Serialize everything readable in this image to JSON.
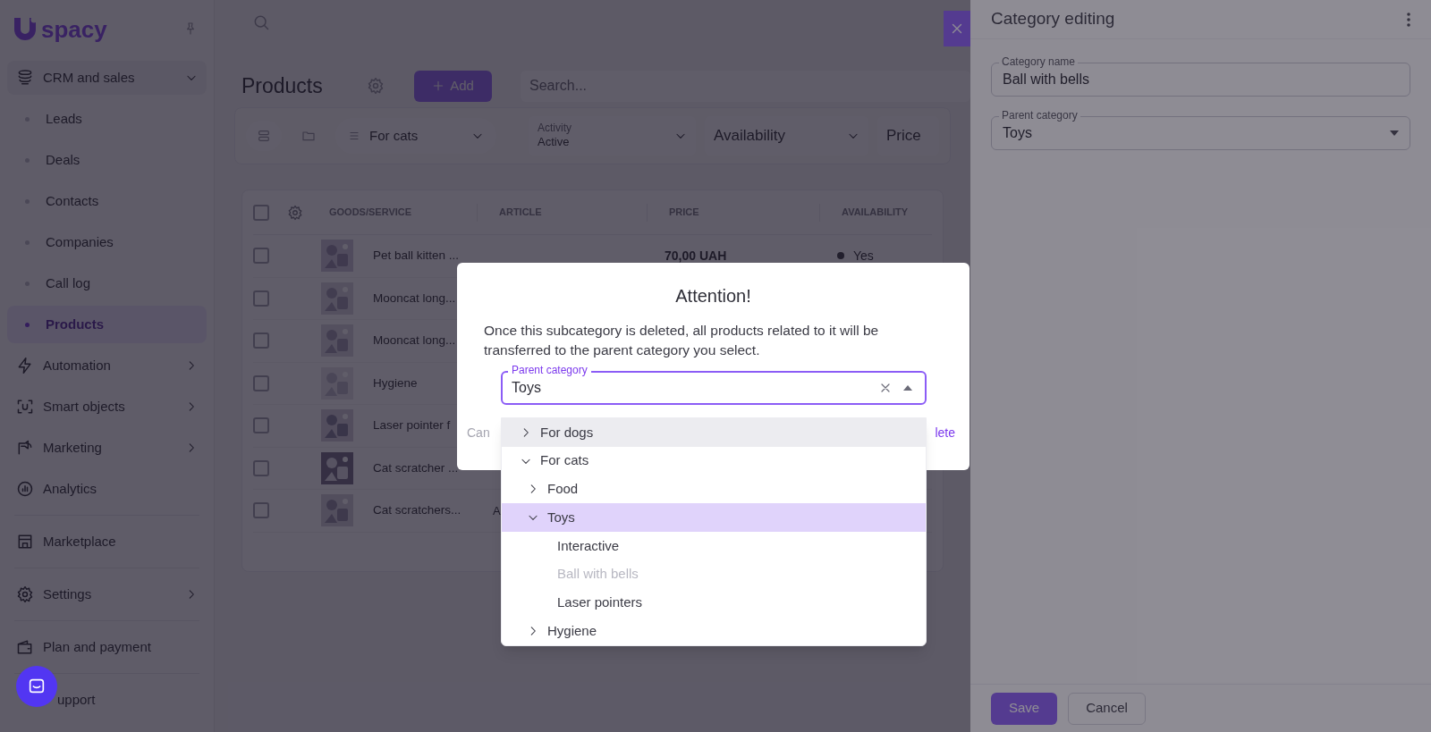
{
  "sidebar": {
    "logo": "spacy",
    "sections": [
      [
        {
          "label": "CRM and sales",
          "expanded": true,
          "children": [
            {
              "label": "Leads",
              "selected": false
            },
            {
              "label": "Deals",
              "selected": false
            },
            {
              "label": "Contacts",
              "selected": false
            },
            {
              "label": "Companies",
              "selected": false
            },
            {
              "label": "Call log",
              "selected": false
            },
            {
              "label": "Products",
              "selected": true
            }
          ]
        },
        {
          "label": "Automation",
          "expanded": false
        },
        {
          "label": "Smart objects",
          "expanded": false
        },
        {
          "label": "Marketing",
          "expanded": false
        },
        {
          "label": "Analytics"
        }
      ],
      [
        {
          "label": "Marketplace"
        }
      ],
      [
        {
          "label": "Settings",
          "expanded": false
        }
      ],
      [
        {
          "label": "Plan and payment"
        }
      ],
      [
        {
          "label": "upport"
        }
      ]
    ]
  },
  "products": {
    "title": "Products",
    "add_button": "Add",
    "search_placeholder": "Search...",
    "filters": {
      "category": "For cats",
      "activity_label": "Activity",
      "activity_value": "Active",
      "availability": "Availability",
      "price": "Price"
    },
    "table": {
      "header_checked": false,
      "columns": [
        "GOODS/SERVICE",
        "ARTICLE",
        "PRICE",
        "AVAILABILITY"
      ],
      "rows": [
        {
          "name": "Pet ball kitten ...",
          "price": "70,00 UAH",
          "availability": "Yes",
          "checked": false
        },
        {
          "name": "Mooncat long...",
          "checked": false
        },
        {
          "name": "Mooncat long...",
          "checked": false
        },
        {
          "name": "Hygiene",
          "checked": false
        },
        {
          "name": "Laser pointer f",
          "checked": false
        },
        {
          "name": "Cat scratcher ...",
          "checked": false
        },
        {
          "name": "Cat scratchers...",
          "article": "A",
          "checked": false
        }
      ]
    }
  },
  "drawer": {
    "title": "Category editing",
    "fields": [
      {
        "label": "Category name",
        "value": "Ball with bells",
        "kind": "text"
      },
      {
        "label": "Parent category",
        "value": "Toys",
        "kind": "select"
      }
    ],
    "save_button": "Save",
    "cancel_button": "Cancel"
  },
  "dialog": {
    "title": "Attention!",
    "message": "Once this subcategory is deleted, all products related to it will be transferred to the parent category you select.",
    "field": {
      "label": "Parent category",
      "value": "Toys"
    },
    "cancel_button": "Can",
    "delete_button": "lete",
    "options": [
      {
        "label": "For dogs",
        "expanded": false,
        "selected": false,
        "focused": true,
        "disabled": false
      },
      {
        "label": "For cats",
        "expanded": true,
        "selected": false,
        "focused": false,
        "disabled": false,
        "children": [
          {
            "label": "Food",
            "expanded": false,
            "selected": false,
            "focused": false,
            "disabled": false
          },
          {
            "label": "Toys",
            "expanded": true,
            "selected": true,
            "focused": false,
            "disabled": false,
            "children": [
              {
                "label": "Interactive",
                "selected": false,
                "focused": false,
                "disabled": false
              },
              {
                "label": "Ball with bells",
                "selected": false,
                "focused": false,
                "disabled": true
              },
              {
                "label": "Laser pointers",
                "selected": false,
                "focused": false,
                "disabled": false
              }
            ]
          },
          {
            "label": "Hygiene",
            "expanded": false,
            "selected": false,
            "focused": false,
            "disabled": false
          }
        ]
      }
    ]
  }
}
